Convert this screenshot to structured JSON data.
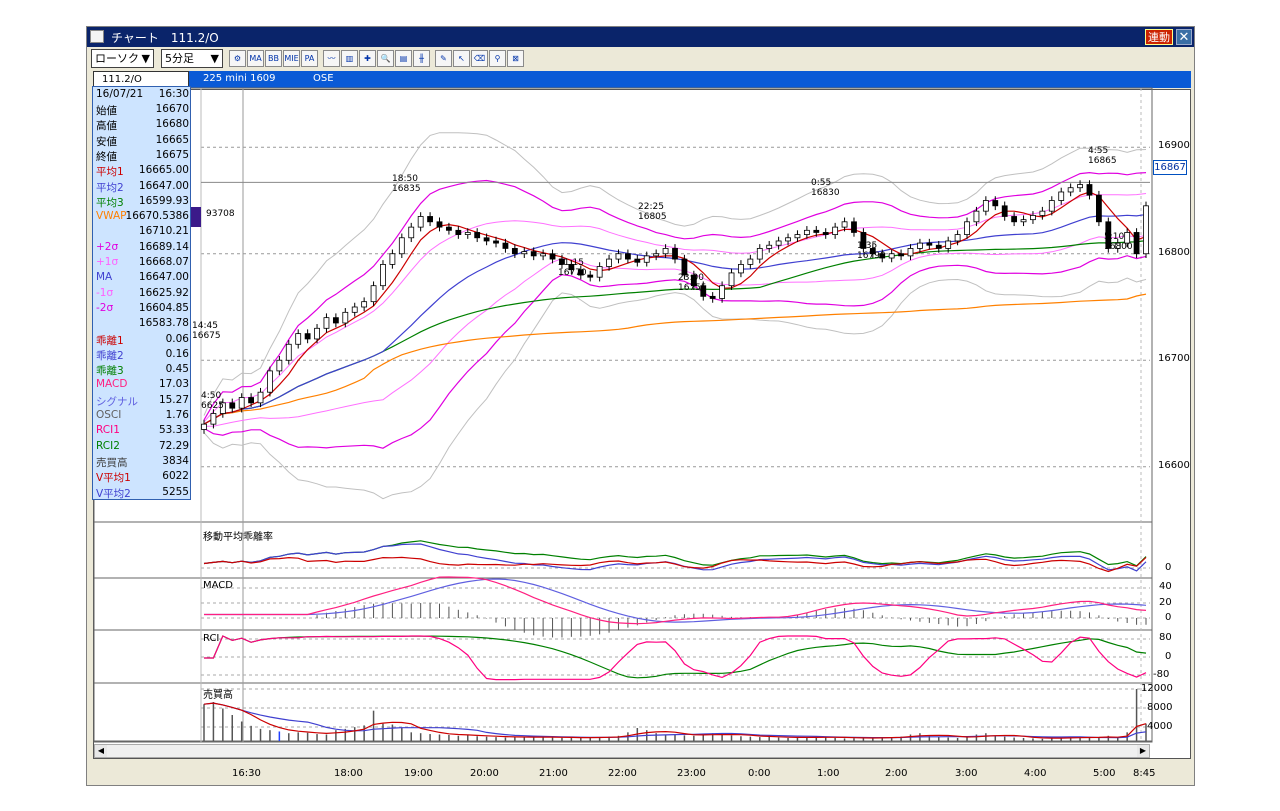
{
  "window": {
    "title": "チャート　111.2/O",
    "link_label": "連動",
    "close_label": "✕"
  },
  "toolbar": {
    "chart_type": "ローソク",
    "interval": "5分足",
    "tools": [
      {
        "icon": "chart-settings-icon",
        "label": "⚙"
      },
      {
        "icon": "ma-icon",
        "label": "MA"
      },
      {
        "icon": "bb-icon",
        "label": "BB"
      },
      {
        "icon": "mie-icon",
        "label": "MIE"
      },
      {
        "icon": "pa-icon",
        "label": "PA"
      },
      {
        "icon": "line-chart-icon",
        "label": "〰"
      },
      {
        "icon": "compare-chart-icon",
        "label": "▥"
      },
      {
        "icon": "crosshair-chart-icon",
        "label": "✚"
      },
      {
        "icon": "zoom-icon",
        "label": "🔍"
      },
      {
        "icon": "notes-icon",
        "label": "▤"
      },
      {
        "icon": "candle-settings-icon",
        "label": "╫"
      },
      {
        "icon": "pen-icon",
        "label": "✎"
      },
      {
        "icon": "pointer-icon",
        "label": "↖"
      },
      {
        "icon": "eraser-icon",
        "label": "⌫"
      },
      {
        "icon": "search-icon",
        "label": "⚲"
      },
      {
        "icon": "trend-tool-icon",
        "label": "⊠"
      }
    ]
  },
  "symbol": {
    "code": "111.2/O",
    "name": "225 mini 1609",
    "exchange": "OSE"
  },
  "info": {
    "date": "16/07/21",
    "time": "16:30",
    "rows": [
      {
        "label": "始値",
        "value": "16670",
        "color": "#000000"
      },
      {
        "label": "高値",
        "value": "16680",
        "color": "#000000"
      },
      {
        "label": "安値",
        "value": "16665",
        "color": "#000000"
      },
      {
        "label": "終値",
        "value": "16675",
        "color": "#000000"
      },
      {
        "label": "平均1",
        "value": "16665.00",
        "color": "#cc0000"
      },
      {
        "label": "平均2",
        "value": "16647.00",
        "color": "#4040d0"
      },
      {
        "label": "平均3",
        "value": "16599.93",
        "color": "#008000"
      },
      {
        "label": "VWAP",
        "value": "16670.5386",
        "color": "#ff8000"
      },
      {
        "label": "",
        "value": "16710.21",
        "color": "#000000"
      },
      {
        "label": "+2σ",
        "value": "16689.14",
        "color": "#e000e0"
      },
      {
        "label": "+1σ",
        "value": "16668.07",
        "color": "#ff60ff"
      },
      {
        "label": "MA",
        "value": "16647.00",
        "color": "#4040d0"
      },
      {
        "label": "-1σ",
        "value": "16625.92",
        "color": "#ff60ff"
      },
      {
        "label": "-2σ",
        "value": "16604.85",
        "color": "#e000e0"
      },
      {
        "label": "",
        "value": "16583.78",
        "color": "#000000"
      },
      {
        "label": "乖離1",
        "value": "0.06",
        "color": "#cc0000"
      },
      {
        "label": "乖離2",
        "value": "0.16",
        "color": "#4040d0"
      },
      {
        "label": "乖離3",
        "value": "0.45",
        "color": "#008000"
      },
      {
        "label": "MACD",
        "value": "17.03",
        "color": "#ff2080"
      },
      {
        "label": "シグナル",
        "value": "15.27",
        "color": "#6060e0"
      },
      {
        "label": "OSCI",
        "value": "1.76",
        "color": "#606060"
      },
      {
        "label": "RCI1",
        "value": "53.33",
        "color": "#ff0080"
      },
      {
        "label": "RCI2",
        "value": "72.29",
        "color": "#008000"
      },
      {
        "label": "売買高",
        "value": "3834",
        "color": "#404040"
      },
      {
        "label": "V平均1",
        "value": "6022",
        "color": "#cc0000"
      },
      {
        "label": "V平均2",
        "value": "5255",
        "color": "#4040d0"
      }
    ]
  },
  "cursor_value": "93708",
  "current_price": "16867",
  "annotations": [
    {
      "time": "14:45",
      "value": "16675"
    },
    {
      "time": "4:50",
      "value": "6625"
    },
    {
      "time": "18:50",
      "value": "16835"
    },
    {
      "time": "22:25",
      "value": "16805"
    },
    {
      "time": "21:15",
      "value": "16770"
    },
    {
      "time": "23:00",
      "value": "16755"
    },
    {
      "time": "0:55",
      "value": "16830"
    },
    {
      "time": "1:35",
      "value": "16790"
    },
    {
      "time": "4:55",
      "value": "16865"
    },
    {
      "time": "5:10",
      "value": "16800"
    }
  ],
  "price_axis": [
    "16900",
    "16800",
    "16700",
    "16600"
  ],
  "panels": {
    "kairi": {
      "title": "移動平均乖離率",
      "ticks": [
        "0"
      ]
    },
    "macd": {
      "title": "MACD",
      "ticks": [
        "40",
        "20",
        "0"
      ]
    },
    "rci": {
      "title": "RCI",
      "ticks": [
        "80",
        "0",
        "-80"
      ]
    },
    "volume": {
      "title": "売買高",
      "ticks": [
        "12000",
        "8000",
        "4000"
      ]
    }
  },
  "time_axis": [
    "16:30",
    "18:00",
    "19:00",
    "20:00",
    "21:00",
    "22:00",
    "23:00",
    "0:00",
    "1:00",
    "2:00",
    "3:00",
    "4:00",
    "5:00",
    "8:45"
  ],
  "colors": {
    "title_bar": "#0a246a",
    "symbol_bar": "#0a5ad6",
    "ma1": "#cc0000",
    "ma2": "#4040d0",
    "ma3": "#008000",
    "vwap": "#ff8000",
    "bb": "#e000e0",
    "bb_outer": "#c0c0c0"
  },
  "chart_data": {
    "type": "candlestick",
    "ylim": [
      16550,
      16950
    ],
    "close": [
      16640,
      16650,
      16660,
      16655,
      16665,
      16660,
      16670,
      16690,
      16700,
      16715,
      16725,
      16720,
      16730,
      16740,
      16735,
      16745,
      16750,
      16755,
      16770,
      16790,
      16800,
      16815,
      16825,
      16835,
      16830,
      16825,
      16822,
      16818,
      16820,
      16815,
      16812,
      16810,
      16805,
      16800,
      16802,
      16798,
      16800,
      16795,
      16790,
      16785,
      16780,
      16778,
      16788,
      16795,
      16800,
      16795,
      16792,
      16798,
      16800,
      16805,
      16795,
      16780,
      16770,
      16760,
      16758,
      16770,
      16782,
      16790,
      16795,
      16805,
      16808,
      16812,
      16815,
      16818,
      16822,
      16820,
      16818,
      16825,
      16830,
      16820,
      16805,
      16800,
      16796,
      16800,
      16798,
      16805,
      16810,
      16808,
      16805,
      16812,
      16818,
      16830,
      16840,
      16850,
      16845,
      16835,
      16830,
      16832,
      16836,
      16840,
      16850,
      16858,
      16862,
      16865,
      16855,
      16830,
      16805,
      16810,
      16820,
      16800,
      16845
    ],
    "volume": [
      8500,
      9000,
      7500,
      6000,
      4500,
      3500,
      2800,
      2500,
      2200,
      1800,
      2000,
      1900,
      1600,
      1500,
      2500,
      2800,
      3200,
      3600,
      7000,
      4000,
      3800,
      3000,
      2000,
      1800,
      1600,
      1500,
      1400,
      1200,
      1300,
      1100,
      1000,
      900,
      800,
      950,
      1000,
      850,
      900,
      800,
      750,
      800,
      700,
      850,
      900,
      1000,
      1200,
      2000,
      3000,
      2500,
      1800,
      1500,
      1400,
      1300,
      1200,
      1600,
      1800,
      1500,
      1300,
      1100,
      1000,
      900,
      1000,
      800,
      700,
      800,
      900,
      1000,
      900,
      700,
      600,
      650,
      700,
      800,
      850,
      900,
      1000,
      1500,
      1800,
      1200,
      1000,
      800,
      700,
      900,
      1500,
      1800,
      1200,
      1000,
      800,
      700,
      600,
      500,
      700,
      800,
      1000,
      800,
      700,
      900,
      1200,
      800,
      2000,
      12000,
      4000
    ]
  }
}
